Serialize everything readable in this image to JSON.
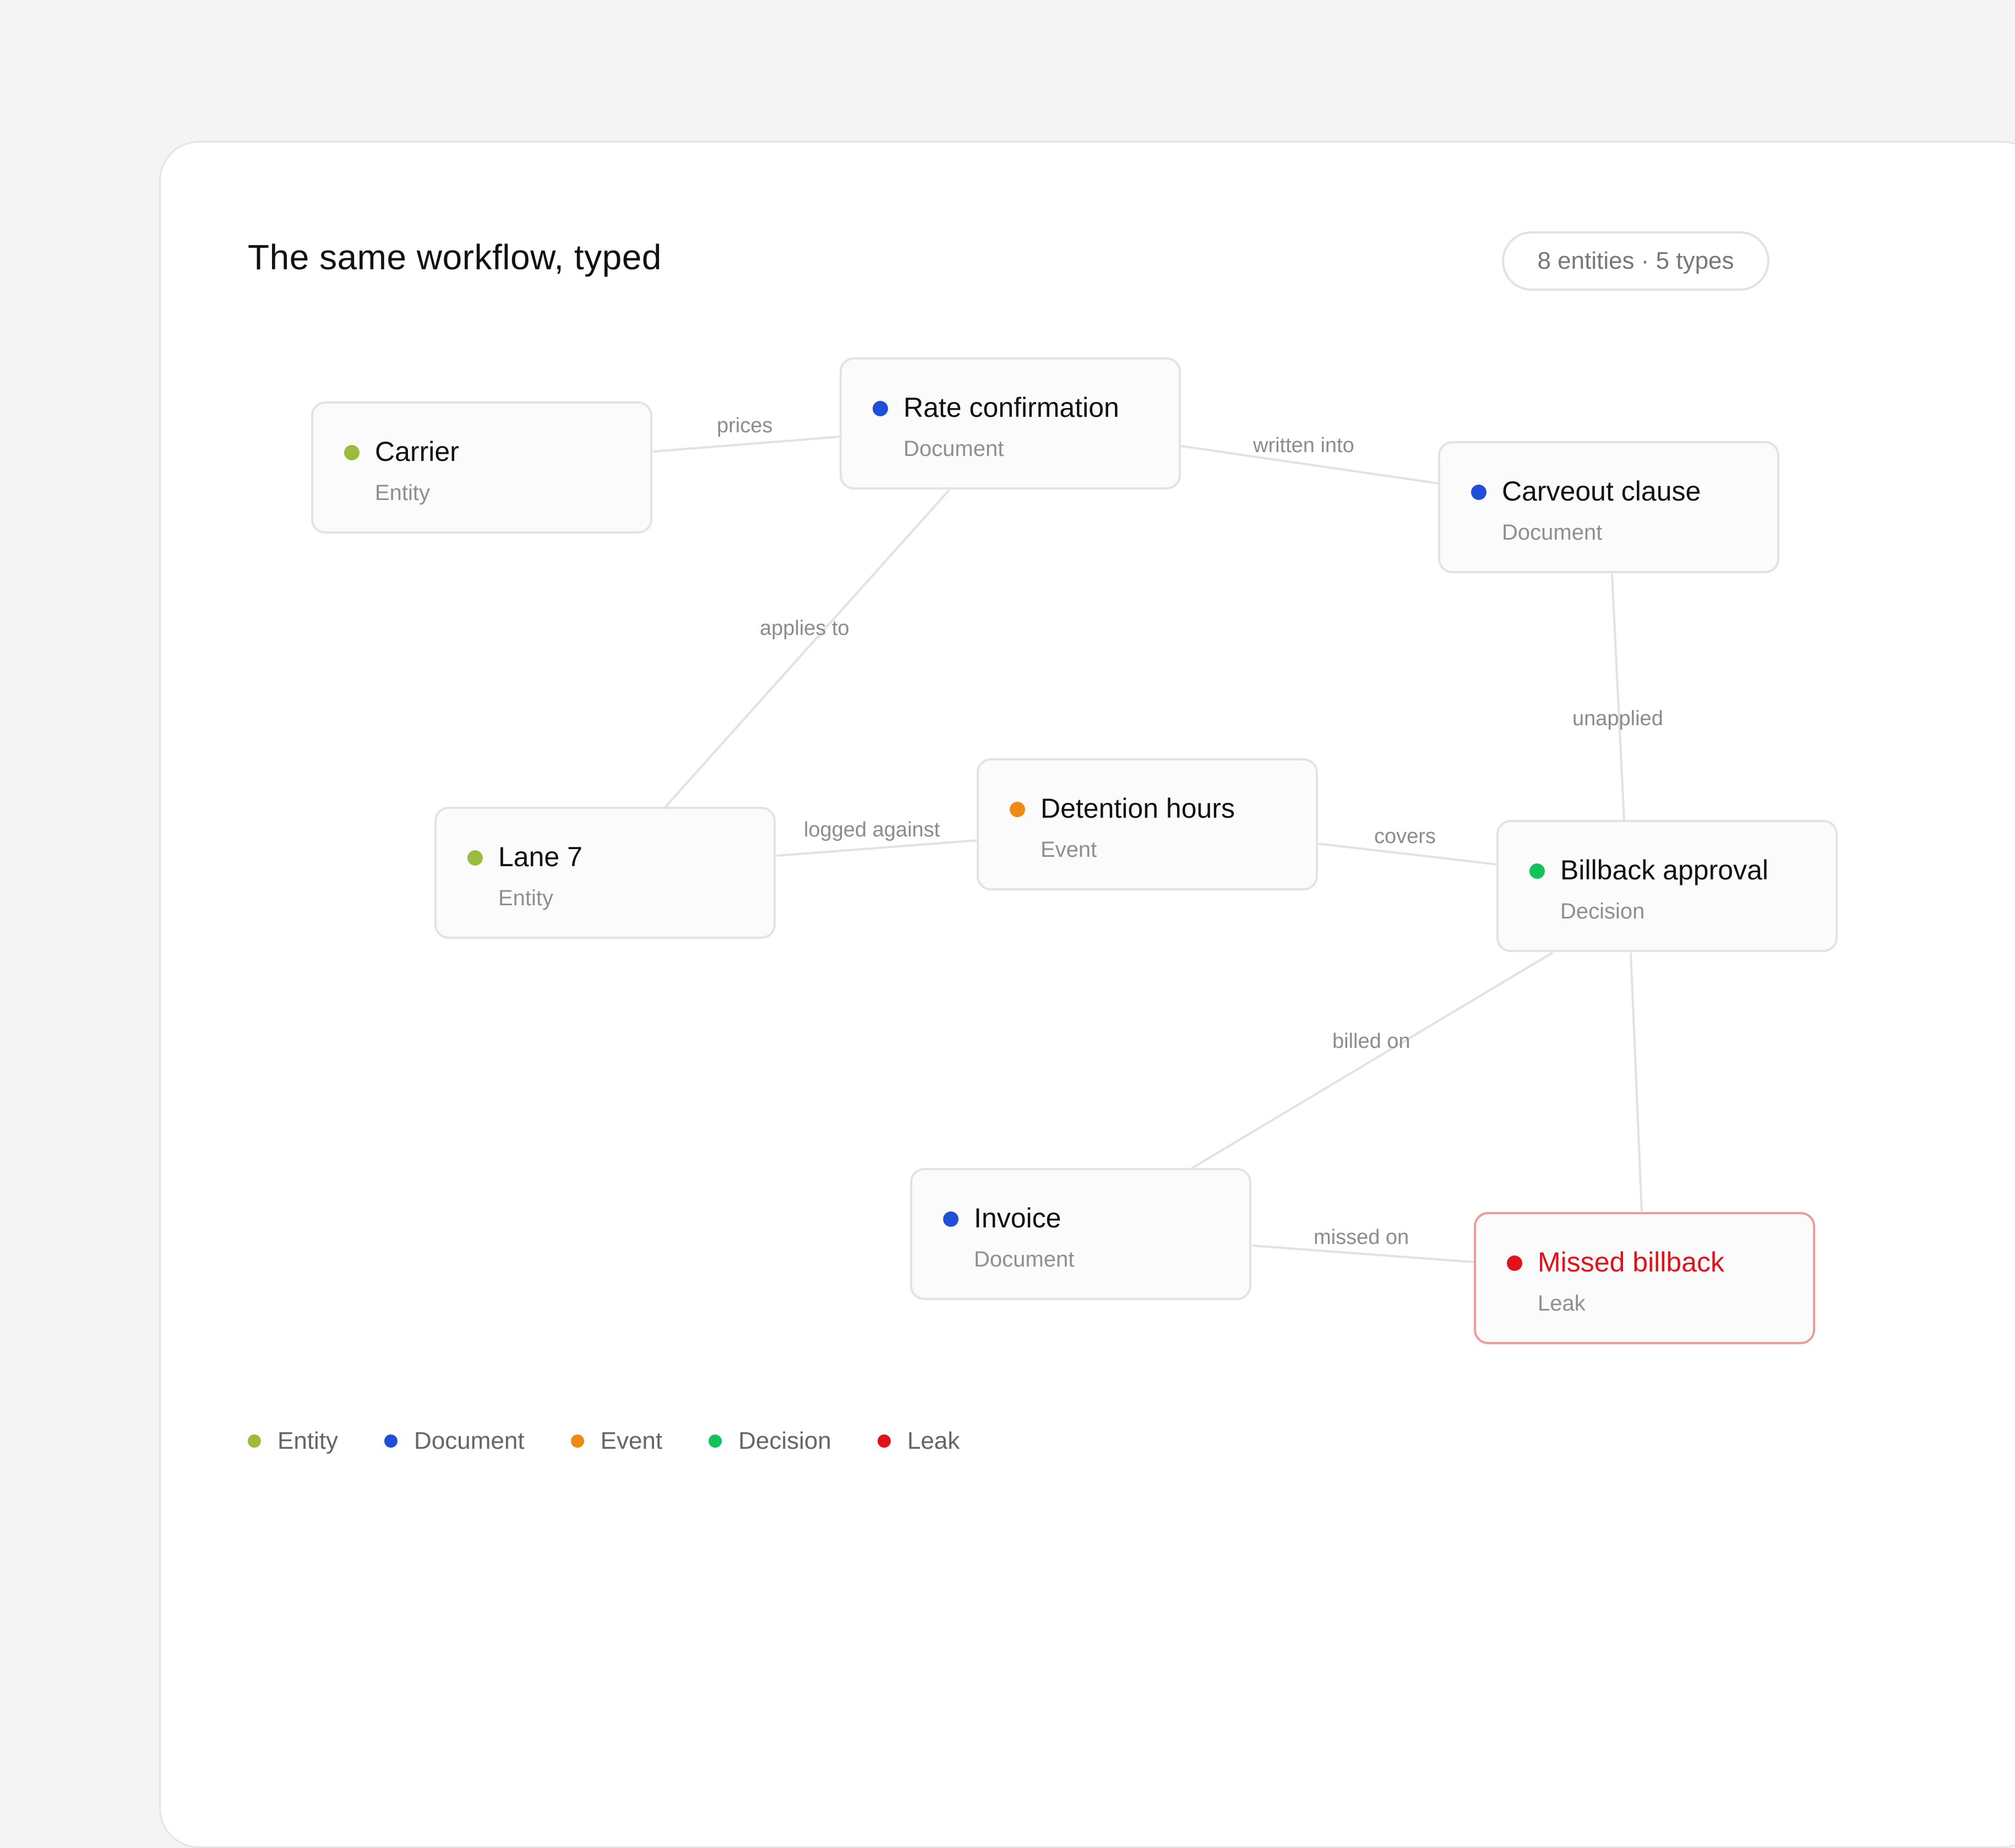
{
  "title": "The same workflow, typed",
  "badge": "8 entities · 5 types",
  "colors": {
    "entity": "#9bbb3c",
    "document": "#1f4fd6",
    "event": "#ef8a12",
    "decision": "#12c35a",
    "leak": "#e0131a",
    "leak_border": "#f09a9a",
    "edge": "#e2e2e2"
  },
  "nodes": {
    "carrier": {
      "label": "Carrier",
      "type": "Entity"
    },
    "rate_confirmation": {
      "label": "Rate confirmation",
      "type": "Document"
    },
    "carveout_clause": {
      "label": "Carveout clause",
      "type": "Document"
    },
    "lane7": {
      "label": "Lane 7",
      "type": "Entity"
    },
    "detention_hours": {
      "label": "Detention hours",
      "type": "Event"
    },
    "billback_approval": {
      "label": "Billback approval",
      "type": "Decision"
    },
    "invoice": {
      "label": "Invoice",
      "type": "Document"
    },
    "missed_billback": {
      "label": "Missed billback",
      "type": "Leak"
    }
  },
  "edges": {
    "prices": "prices",
    "written_into": "written into",
    "applies_to": "applies to",
    "unapplied": "unapplied",
    "logged_against": "logged against",
    "covers": "covers",
    "billed_on": "billed on",
    "missed_on": "missed on"
  },
  "legend": [
    "Entity",
    "Document",
    "Event",
    "Decision",
    "Leak"
  ]
}
